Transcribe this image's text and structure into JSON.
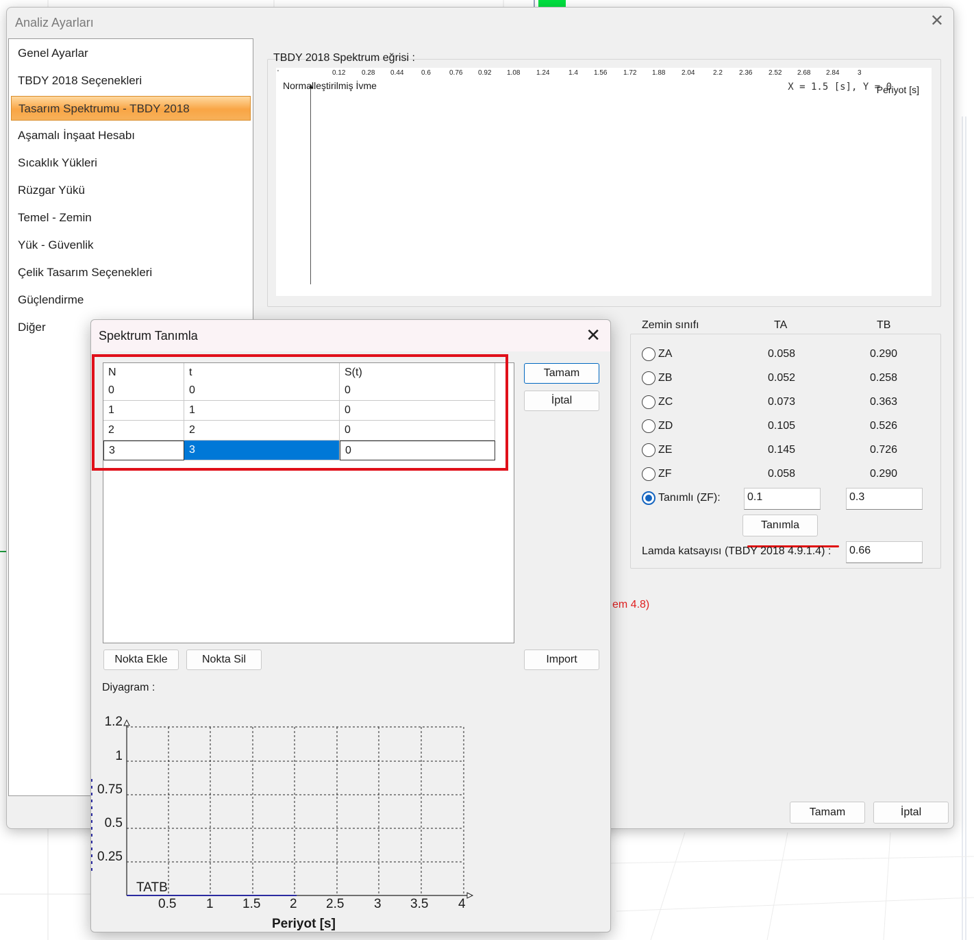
{
  "main_dialog": {
    "title": "Analiz Ayarları",
    "close_glyph": "✕",
    "nav_items": [
      {
        "label": "Genel Ayarlar"
      },
      {
        "label": "TBDY 2018 Seçenekleri"
      },
      {
        "label": "Tasarım Spektrumu - TBDY 2018",
        "selected": true
      },
      {
        "label": "Aşamalı İnşaat Hesabı"
      },
      {
        "label": "Sıcaklık Yükleri"
      },
      {
        "label": "Rüzgar Yükü"
      },
      {
        "label": "Temel - Zemin"
      },
      {
        "label": "Yük - Güvenlik"
      },
      {
        "label": "Çelik Tasarım Seçenekleri"
      },
      {
        "label": "Güçlendirme"
      },
      {
        "label": "Diğer"
      }
    ],
    "spectrum": {
      "title": "TBDY 2018 Spektrum eğrisi :",
      "ylabel": "Normalleştirilmiş İvme",
      "coord_readout": "X = 1.5 [s],  Y = 0",
      "xlabel": "Periyot [s]",
      "x_ticks": [
        "0.12",
        "0.28",
        "0.44",
        "0.6",
        "0.76",
        "0.92",
        "1.08",
        "1.24",
        "1.4",
        "1.56",
        "1.72",
        "1.88",
        "2.04",
        "2.2",
        "2.36",
        "2.52",
        "2.68",
        "2.84",
        "3"
      ]
    },
    "zemin": {
      "header_class": "Zemin sınıfı",
      "header_ta": "TA",
      "header_tb": "TB",
      "rows": [
        {
          "label": "ZA",
          "ta": "0.058",
          "tb": "0.290"
        },
        {
          "label": "ZB",
          "ta": "0.052",
          "tb": "0.258"
        },
        {
          "label": "ZC",
          "ta": "0.073",
          "tb": "0.363"
        },
        {
          "label": "ZD",
          "ta": "0.105",
          "tb": "0.526"
        },
        {
          "label": "ZE",
          "ta": "0.145",
          "tb": "0.726"
        },
        {
          "label": "ZF",
          "ta": "0.058",
          "tb": "0.290"
        }
      ],
      "custom_label": "Tanımlı (ZF):",
      "custom_ta": "0.1",
      "custom_tb": "0.3",
      "define_button": "Tanımla",
      "lamda_label": "Lamda katsayısı (TBDY 2018 4.9.1.4) :",
      "lamda_value": "0.66",
      "selected_option": "Tanımlı (ZF)"
    },
    "red_note": "em 4.8)",
    "ok_button": "Tamam",
    "cancel_button": "İptal"
  },
  "sub_dialog": {
    "title": "Spektrum Tanımla",
    "close_glyph": "✕",
    "grid": {
      "columns": [
        "N",
        "t",
        "S(t)"
      ],
      "rows": [
        [
          "0",
          "0",
          "0"
        ],
        [
          "1",
          "1",
          "0"
        ],
        [
          "2",
          "2",
          "0"
        ],
        [
          "3",
          "3",
          "0"
        ]
      ],
      "selected_row": 3,
      "selected_col": 1
    },
    "ok_button": "Tamam",
    "cancel_button": "İptal",
    "add_point_button": "Nokta Ekle",
    "delete_point_button": "Nokta Sil",
    "import_button": "Import",
    "diagram_label": "Diyagram :",
    "diagram": {
      "y_ticks": [
        "1.2",
        "1",
        "0.75",
        "0.5",
        "0.25"
      ],
      "x_ticks": [
        "0.5",
        "1",
        "1.5",
        "2",
        "2.5",
        "3",
        "3.5",
        "4"
      ],
      "xlabel": "Periyot [s]",
      "corner_label": "TATB"
    }
  },
  "colors": {
    "selection": "#0078d7",
    "highlight_box": "#e0101a",
    "nav_selected": "#f9a545",
    "radio_checked": "#1565c0"
  }
}
